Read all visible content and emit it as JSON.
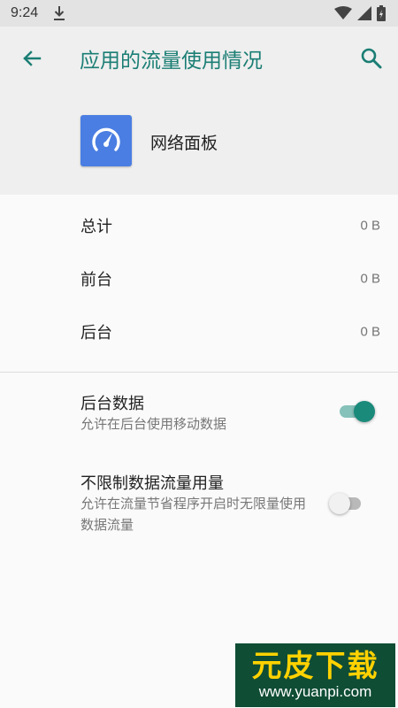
{
  "status_bar": {
    "time": "9:24",
    "icons": [
      "download-icon",
      "wifi-icon",
      "cell-signal-icon",
      "battery-icon"
    ]
  },
  "header": {
    "title": "应用的流量使用情况",
    "back_icon": "back-arrow-icon",
    "search_icon": "search-icon",
    "accent_color": "#1a7e74"
  },
  "app": {
    "name": "网络面板",
    "icon": "speedometer-icon",
    "icon_color": "#4a7ee2"
  },
  "usage": [
    {
      "label": "总计",
      "value": "0 B"
    },
    {
      "label": "前台",
      "value": "0 B"
    },
    {
      "label": "后台",
      "value": "0 B"
    }
  ],
  "settings": {
    "background_data": {
      "title": "后台数据",
      "summary": "允许在后台使用移动数据",
      "enabled": true
    },
    "unrestricted_data": {
      "title": "不限制数据流量用量",
      "summary": "允许在流量节省程序开启时无限量使用数据流量",
      "enabled": false
    }
  },
  "watermark": {
    "brand": "元皮下载",
    "url": "www.yuanpi.com"
  }
}
